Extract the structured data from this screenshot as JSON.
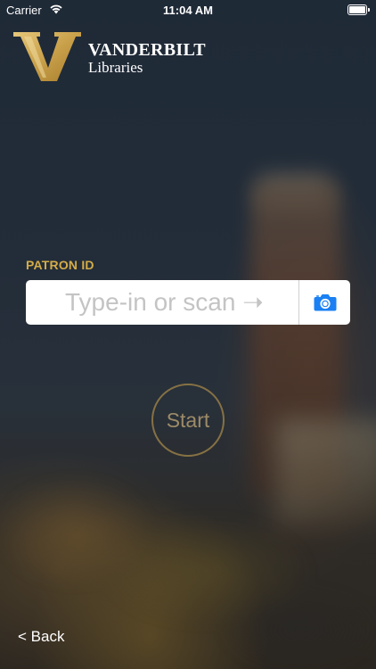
{
  "status_bar": {
    "carrier": "Carrier",
    "time": "11:04 AM"
  },
  "logo": {
    "name": "VANDERBILT",
    "subtitle": "Libraries"
  },
  "form": {
    "label": "PATRON ID",
    "placeholder": "Type-in or scan ➝",
    "value": "",
    "scan_icon": "camera-icon"
  },
  "start_label": "Start",
  "back_label": "< Back",
  "colors": {
    "accent_gold": "#d4ad48",
    "camera_blue": "#1a80f3"
  }
}
